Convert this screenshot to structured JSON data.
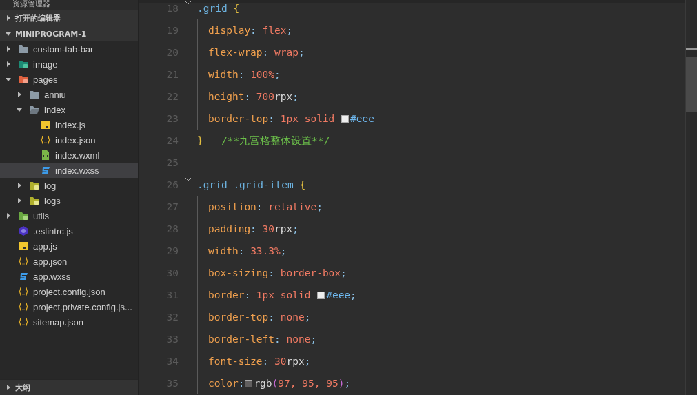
{
  "sidebar": {
    "title": "资源管理器",
    "sections": [
      {
        "label": "打开的编辑器",
        "expanded": false
      },
      {
        "label": "MINIPROGRAM-1",
        "expanded": true
      }
    ],
    "tree": [
      {
        "name": "custom-tab-bar",
        "kind": "folder",
        "expanded": false,
        "selected": false
      },
      {
        "name": "image",
        "kind": "imagefolder",
        "expanded": false,
        "selected": false
      },
      {
        "name": "pages",
        "kind": "pagesfolder",
        "expanded": true,
        "selected": false,
        "children": [
          {
            "name": "anniu",
            "kind": "folder",
            "expanded": false,
            "selected": false
          },
          {
            "name": "index",
            "kind": "openfolder",
            "expanded": true,
            "selected": false,
            "children": [
              {
                "name": "index.js",
                "kind": "js",
                "selected": false
              },
              {
                "name": "index.json",
                "kind": "json",
                "selected": false
              },
              {
                "name": "index.wxml",
                "kind": "wxml",
                "selected": false
              },
              {
                "name": "index.wxss",
                "kind": "wxss",
                "selected": true
              }
            ]
          },
          {
            "name": "log",
            "kind": "logfolder",
            "expanded": false,
            "selected": false
          },
          {
            "name": "logs",
            "kind": "logfolder",
            "expanded": false,
            "selected": false
          }
        ]
      },
      {
        "name": "utils",
        "kind": "utilsfolder",
        "expanded": false,
        "selected": false
      },
      {
        "name": ".eslintrc.js",
        "kind": "eslint",
        "selected": false
      },
      {
        "name": "app.js",
        "kind": "js",
        "selected": false
      },
      {
        "name": "app.json",
        "kind": "json",
        "selected": false
      },
      {
        "name": "app.wxss",
        "kind": "wxss",
        "selected": false
      },
      {
        "name": "project.config.json",
        "kind": "json",
        "selected": false
      },
      {
        "name": "project.private.config.js...",
        "kind": "json",
        "selected": false
      },
      {
        "name": "sitemap.json",
        "kind": "json",
        "selected": false
      }
    ],
    "outline": {
      "label": "大纲",
      "expanded": false
    }
  },
  "editor": {
    "lines": [
      {
        "number": "18",
        "foldable": true,
        "indented": false,
        "tokens": [
          {
            "kind": "selector",
            "text": ".grid"
          },
          {
            "kind": "brace",
            "text": " {"
          }
        ]
      },
      {
        "number": "19",
        "foldable": false,
        "indented": true,
        "tokens": [
          {
            "kind": "property",
            "text": "display"
          },
          {
            "kind": "punct",
            "text": ": "
          },
          {
            "kind": "value",
            "text": "flex"
          },
          {
            "kind": "punct",
            "text": ";"
          }
        ]
      },
      {
        "number": "20",
        "foldable": false,
        "indented": true,
        "tokens": [
          {
            "kind": "property",
            "text": "flex-wrap"
          },
          {
            "kind": "punct",
            "text": ": "
          },
          {
            "kind": "value",
            "text": "wrap"
          },
          {
            "kind": "punct",
            "text": ";"
          }
        ]
      },
      {
        "number": "21",
        "foldable": false,
        "indented": true,
        "tokens": [
          {
            "kind": "property",
            "text": "width"
          },
          {
            "kind": "punct",
            "text": ": "
          },
          {
            "kind": "value",
            "text": "100%"
          },
          {
            "kind": "punct",
            "text": ";"
          }
        ]
      },
      {
        "number": "22",
        "foldable": false,
        "indented": true,
        "tokens": [
          {
            "kind": "property",
            "text": "height"
          },
          {
            "kind": "punct",
            "text": ": "
          },
          {
            "kind": "value",
            "text": "700"
          },
          {
            "kind": "unit",
            "text": "rpx"
          },
          {
            "kind": "punct",
            "text": ";"
          }
        ]
      },
      {
        "number": "23",
        "foldable": false,
        "indented": true,
        "tokens": [
          {
            "kind": "property",
            "text": "border-top"
          },
          {
            "kind": "punct",
            "text": ": "
          },
          {
            "kind": "value",
            "text": "1px solid "
          },
          {
            "kind": "swatch",
            "color": "#eeeeee"
          },
          {
            "kind": "hex",
            "text": "#eee"
          }
        ]
      },
      {
        "number": "24",
        "foldable": false,
        "indented": false,
        "tokens": [
          {
            "kind": "brace",
            "text": "}"
          },
          {
            "kind": "comment",
            "text": "   /**九宫格整体设置**/"
          }
        ]
      },
      {
        "number": "25",
        "foldable": false,
        "indented": false
      },
      {
        "number": "26",
        "foldable": true,
        "indented": false,
        "tokens": [
          {
            "kind": "selector",
            "text": ".grid .grid-item"
          },
          {
            "kind": "brace",
            "text": " {"
          }
        ]
      },
      {
        "number": "27",
        "foldable": false,
        "indented": true,
        "tokens": [
          {
            "kind": "property",
            "text": "position"
          },
          {
            "kind": "punct",
            "text": ": "
          },
          {
            "kind": "value",
            "text": "relative"
          },
          {
            "kind": "punct",
            "text": ";"
          }
        ]
      },
      {
        "number": "28",
        "foldable": false,
        "indented": true,
        "tokens": [
          {
            "kind": "property",
            "text": "padding"
          },
          {
            "kind": "punct",
            "text": ": "
          },
          {
            "kind": "value",
            "text": "30"
          },
          {
            "kind": "unit",
            "text": "rpx"
          },
          {
            "kind": "punct",
            "text": ";"
          }
        ]
      },
      {
        "number": "29",
        "foldable": false,
        "indented": true,
        "tokens": [
          {
            "kind": "property",
            "text": "width"
          },
          {
            "kind": "punct",
            "text": ": "
          },
          {
            "kind": "value",
            "text": "33.3%"
          },
          {
            "kind": "punct",
            "text": ";"
          }
        ]
      },
      {
        "number": "30",
        "foldable": false,
        "indented": true,
        "tokens": [
          {
            "kind": "property",
            "text": "box-sizing"
          },
          {
            "kind": "punct",
            "text": ": "
          },
          {
            "kind": "value",
            "text": "border-box"
          },
          {
            "kind": "punct",
            "text": ";"
          }
        ]
      },
      {
        "number": "31",
        "foldable": false,
        "indented": true,
        "tokens": [
          {
            "kind": "property",
            "text": "border"
          },
          {
            "kind": "punct",
            "text": ": "
          },
          {
            "kind": "value",
            "text": "1px solid "
          },
          {
            "kind": "swatch",
            "color": "#eeeeee"
          },
          {
            "kind": "hex",
            "text": "#eee"
          },
          {
            "kind": "punct",
            "text": ";"
          }
        ]
      },
      {
        "number": "32",
        "foldable": false,
        "indented": true,
        "tokens": [
          {
            "kind": "property",
            "text": "border-top"
          },
          {
            "kind": "punct",
            "text": ": "
          },
          {
            "kind": "value",
            "text": "none"
          },
          {
            "kind": "punct",
            "text": ";"
          }
        ]
      },
      {
        "number": "33",
        "foldable": false,
        "indented": true,
        "tokens": [
          {
            "kind": "property",
            "text": "border-left"
          },
          {
            "kind": "punct",
            "text": ": "
          },
          {
            "kind": "value",
            "text": "none"
          },
          {
            "kind": "punct",
            "text": ";"
          }
        ]
      },
      {
        "number": "34",
        "foldable": false,
        "indented": true,
        "tokens": [
          {
            "kind": "property",
            "text": "font-size"
          },
          {
            "kind": "punct",
            "text": ": "
          },
          {
            "kind": "value",
            "text": "30"
          },
          {
            "kind": "unit",
            "text": "rpx"
          },
          {
            "kind": "punct",
            "text": ";"
          }
        ]
      },
      {
        "number": "35",
        "foldable": false,
        "indented": true,
        "tokens": [
          {
            "kind": "property",
            "text": "color"
          },
          {
            "kind": "punct",
            "text": ":"
          },
          {
            "kind": "swatch",
            "color": "#615f5f"
          },
          {
            "kind": "unit",
            "text": "rgb"
          },
          {
            "kind": "paren",
            "text": "("
          },
          {
            "kind": "value",
            "text": "97, 95, 95"
          },
          {
            "kind": "paren",
            "text": ")"
          },
          {
            "kind": "punct",
            "text": ";"
          }
        ]
      }
    ]
  }
}
